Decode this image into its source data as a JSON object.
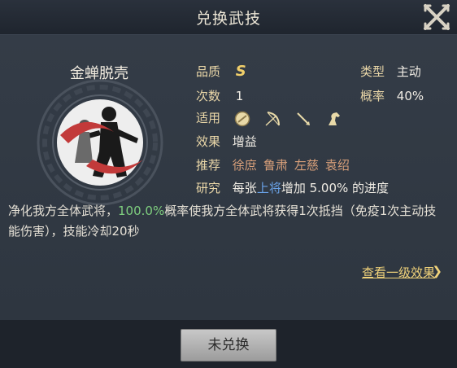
{
  "header": {
    "title": "兑换武技"
  },
  "skill": {
    "name": "金蝉脱壳",
    "quality_label": "品质",
    "quality": "S",
    "type_label": "类型",
    "type": "主动",
    "count_label": "次数",
    "count": "1",
    "rate_label": "概率",
    "rate": "40%",
    "apply_label": "适用",
    "apply_icons": [
      "shield-icon",
      "bow-icon",
      "spear-icon",
      "horse-icon"
    ],
    "effect_label": "效果",
    "effect": "增益",
    "recommend_label": "推荐",
    "recommend": [
      "徐庶",
      "鲁肃",
      "左慈",
      "袁绍"
    ],
    "research_label": "研究",
    "research_pre": "每张",
    "research_hl": "上将",
    "research_post": "增加 5.00% 的进度",
    "desc_pre": "净化我方全体武将，",
    "desc_pct": "100.0%",
    "desc_post": "概率使我方全体武将获得1次抵挡（免疫1次主动技能伤害），技能冷却20秒"
  },
  "more_link": "查看一级效果",
  "more_arrow": "❯",
  "button": {
    "label": "未兑换"
  },
  "colors": {
    "bg": "#2e3640",
    "label": "#ead7a8",
    "quality": "#f1cf6a",
    "recommend": "#d9a07a",
    "highlight_blue": "#6aa3e8",
    "highlight_green": "#7fcf7f",
    "link": "#f0d27a"
  }
}
